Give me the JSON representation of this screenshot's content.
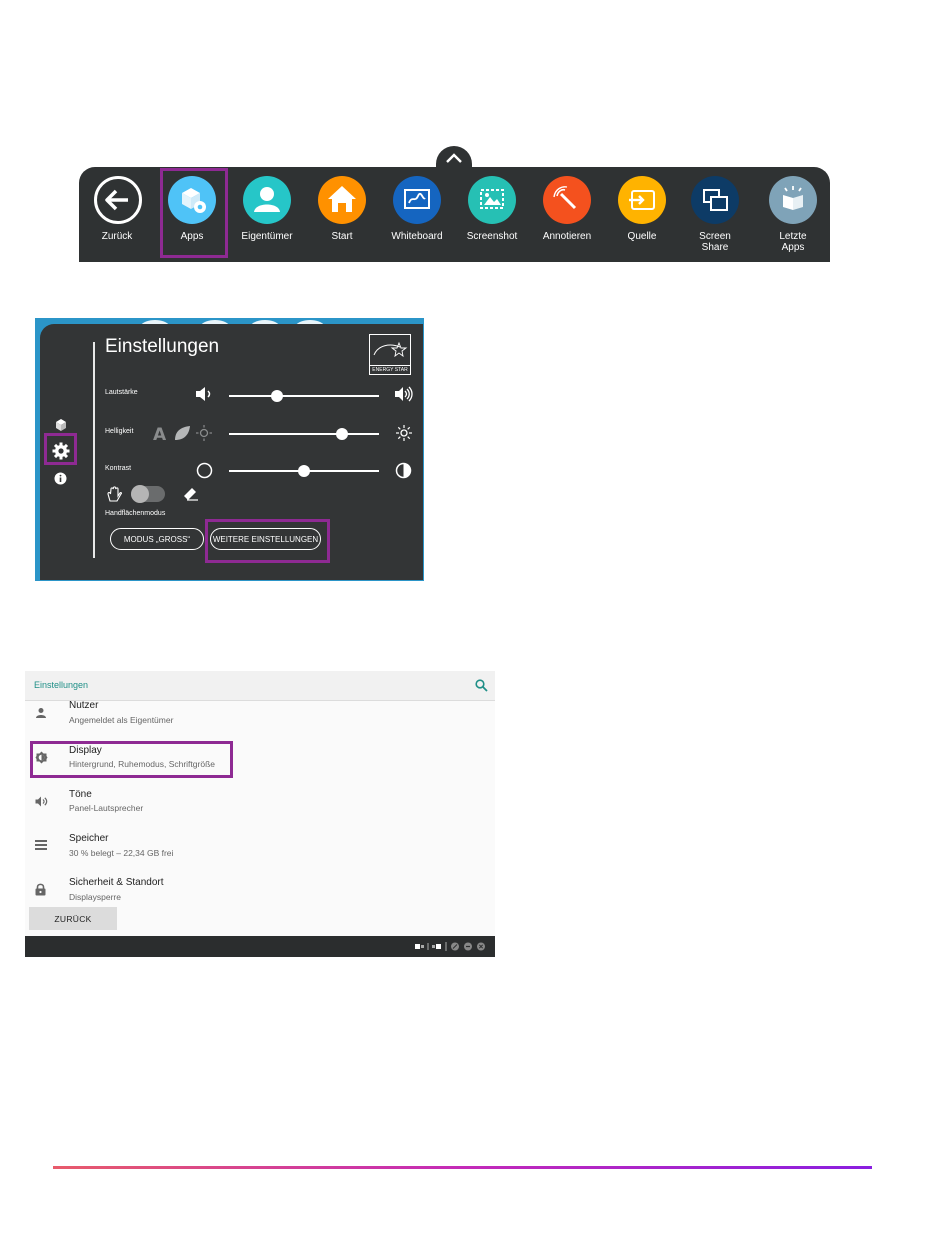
{
  "toolbar": {
    "items": [
      {
        "label": "Zurück",
        "icon": "back-arrow-icon",
        "color": "#2f3233"
      },
      {
        "label": "Apps",
        "icon": "apps-cube-gear-icon",
        "color": "#4fc3f7"
      },
      {
        "label": "Eigentümer",
        "icon": "user-icon",
        "color": "#26c6c8"
      },
      {
        "label": "Start",
        "icon": "home-icon",
        "color": "#ff9100"
      },
      {
        "label": "Whiteboard",
        "icon": "whiteboard-icon",
        "color": "#1565c0"
      },
      {
        "label": "Screenshot",
        "icon": "screenshot-icon",
        "color": "#26c0b4"
      },
      {
        "label": "Annotieren",
        "icon": "annotate-icon",
        "color": "#f4511e"
      },
      {
        "label": "Quelle",
        "icon": "input-source-icon",
        "color": "#ffb300"
      },
      {
        "label": "Screen\nShare",
        "icon": "screen-share-icon",
        "color": "#0d3b66"
      },
      {
        "label": "Letzte\nApps",
        "icon": "recent-apps-icon",
        "color": "#7fa3b8"
      }
    ]
  },
  "settings_panel": {
    "title": "Einstellungen",
    "energy_star": "ENERGY STAR",
    "volume": {
      "label": "Lautstärke",
      "level": 0.32
    },
    "brightness": {
      "label": "Helligkeit",
      "level": 0.75
    },
    "contrast": {
      "label": "Kontrast",
      "level": 0.5
    },
    "palm_mode": {
      "label": "Handflächenmodus",
      "on": false
    },
    "buttons": {
      "mode_large": "MODUS „GROSS“",
      "more_settings": "WEITERE EINSTELLUNGEN"
    }
  },
  "android_settings": {
    "title": "Einstellungen",
    "rows": [
      {
        "title": "Nutzer",
        "subtitle": "Angemeldet als Eigentümer",
        "icon": "person-icon"
      },
      {
        "title": "Display",
        "subtitle": "Hintergrund, Ruhemodus, Schriftgröße",
        "icon": "brightness-icon"
      },
      {
        "title": "Töne",
        "subtitle": "Panel-Lautsprecher",
        "icon": "volume-icon"
      },
      {
        "title": "Speicher",
        "subtitle": "30 % belegt – 22,34 GB frei",
        "icon": "storage-icon"
      },
      {
        "title": "Sicherheit & Standort",
        "subtitle": "Displaysperre",
        "icon": "lock-icon"
      }
    ],
    "back_button": "ZURÜCK"
  },
  "colors": {
    "highlight": "#8e2a93",
    "accent_teal": "#1f8f87",
    "dark_panel": "#333536",
    "blue_bg": "#2b95c8"
  }
}
